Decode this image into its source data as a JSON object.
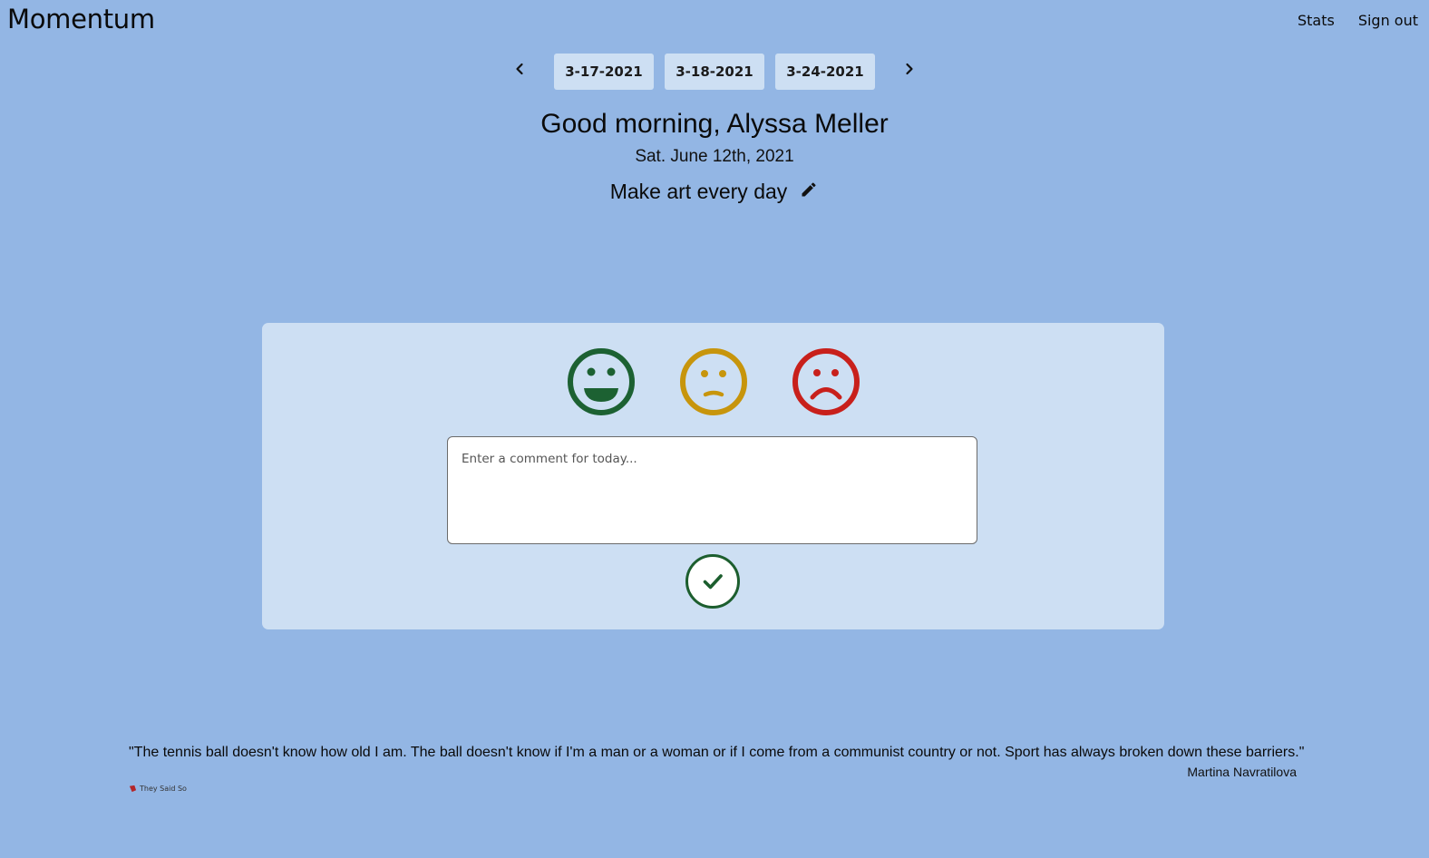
{
  "app": {
    "brand": "Momentum"
  },
  "nav": {
    "stats": "Stats",
    "sign_out": "Sign out"
  },
  "date_nav": {
    "prev_icon": "chevron-left-icon",
    "next_icon": "chevron-right-icon",
    "dates": [
      "3-17-2021",
      "3-18-2021",
      "3-24-2021"
    ]
  },
  "header": {
    "greeting": "Good morning, Alyssa Meller",
    "date": "Sat. June 12th, 2021",
    "goal": "Make art every day",
    "edit_icon": "pencil-icon"
  },
  "mood": {
    "options": [
      {
        "name": "happy",
        "icon": "happy-face-icon",
        "color": "#1c6132"
      },
      {
        "name": "neutral",
        "icon": "neutral-face-icon",
        "color": "#c7950c"
      },
      {
        "name": "sad",
        "icon": "sad-face-icon",
        "color": "#c8201b"
      }
    ]
  },
  "comment": {
    "placeholder": "Enter a comment for today...",
    "value": ""
  },
  "submit": {
    "icon": "check-icon",
    "color": "#1c5e2e"
  },
  "quote": {
    "text": "\"The tennis ball doesn't know how old I am. The ball doesn't know if I'm a man or a woman or if I come from a communist country or not. Sport has always broken down these barriers.\"",
    "author": "Martina Navratilova",
    "attribution": "They Said So"
  },
  "colors": {
    "background": "#93b6e4",
    "card": "#cddff3"
  }
}
